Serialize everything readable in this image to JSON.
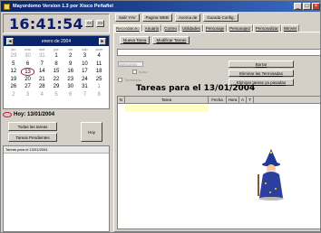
{
  "window": {
    "title": "Mayordomo Version 1.3 por Xisco Peñafiel"
  },
  "clock": {
    "time": "16:41:54",
    "mini_left": "<<",
    "mini_right": ">>"
  },
  "calendar": {
    "month_label": "enero de 2004",
    "prev": "◄",
    "next": "►",
    "day_names": [
      "lun",
      "mar",
      "mié",
      "jue",
      "vie",
      "sáb",
      "dom"
    ],
    "weeks": [
      [
        "29",
        "30",
        "31",
        "1",
        "2",
        "3",
        "4"
      ],
      [
        "5",
        "6",
        "7",
        "8",
        "9",
        "10",
        "11"
      ],
      [
        "12",
        "13",
        "14",
        "15",
        "16",
        "17",
        "18"
      ],
      [
        "19",
        "20",
        "21",
        "22",
        "23",
        "24",
        "25"
      ],
      [
        "26",
        "27",
        "28",
        "29",
        "30",
        "31",
        "1"
      ],
      [
        "2",
        "3",
        "4",
        "5",
        "6",
        "7",
        "8"
      ]
    ],
    "today_label": "Hoy: 13/01/2004"
  },
  "left_buttons": {
    "all": "Todas las tareas",
    "pending": "Tareas Pendientes",
    "hoy": "Hoy"
  },
  "left_list": {
    "caption": "Tareas para el 13/01/2004"
  },
  "menubar": [
    "Salir YAV",
    "Pagina WEB",
    "Acerca de",
    "Guarda Config."
  ],
  "tabs": [
    "Recordatorio",
    "Anuario",
    "Correo",
    "Utilidades",
    "Personaje",
    "Personaje2",
    "Personalizar",
    "WinVer"
  ],
  "task_buttons": {
    "new": "Nueva Tarea",
    "modify": "Modificar Tareas"
  },
  "actions": {
    "borrar": "Borrar",
    "eliminar_terminadas": "Eliminar las Terminadas",
    "eliminar_pasadas": "Eliminar tareas ya pasadas"
  },
  "form": {
    "date": "13/01/2004",
    "aviso": "Aviso",
    "terminada": "Terminada"
  },
  "tareas_title": "Tareas para el 13/01/2004",
  "table": {
    "headers": [
      "N",
      "Tarea",
      "Fecha",
      "Hora",
      "A",
      "T"
    ]
  }
}
